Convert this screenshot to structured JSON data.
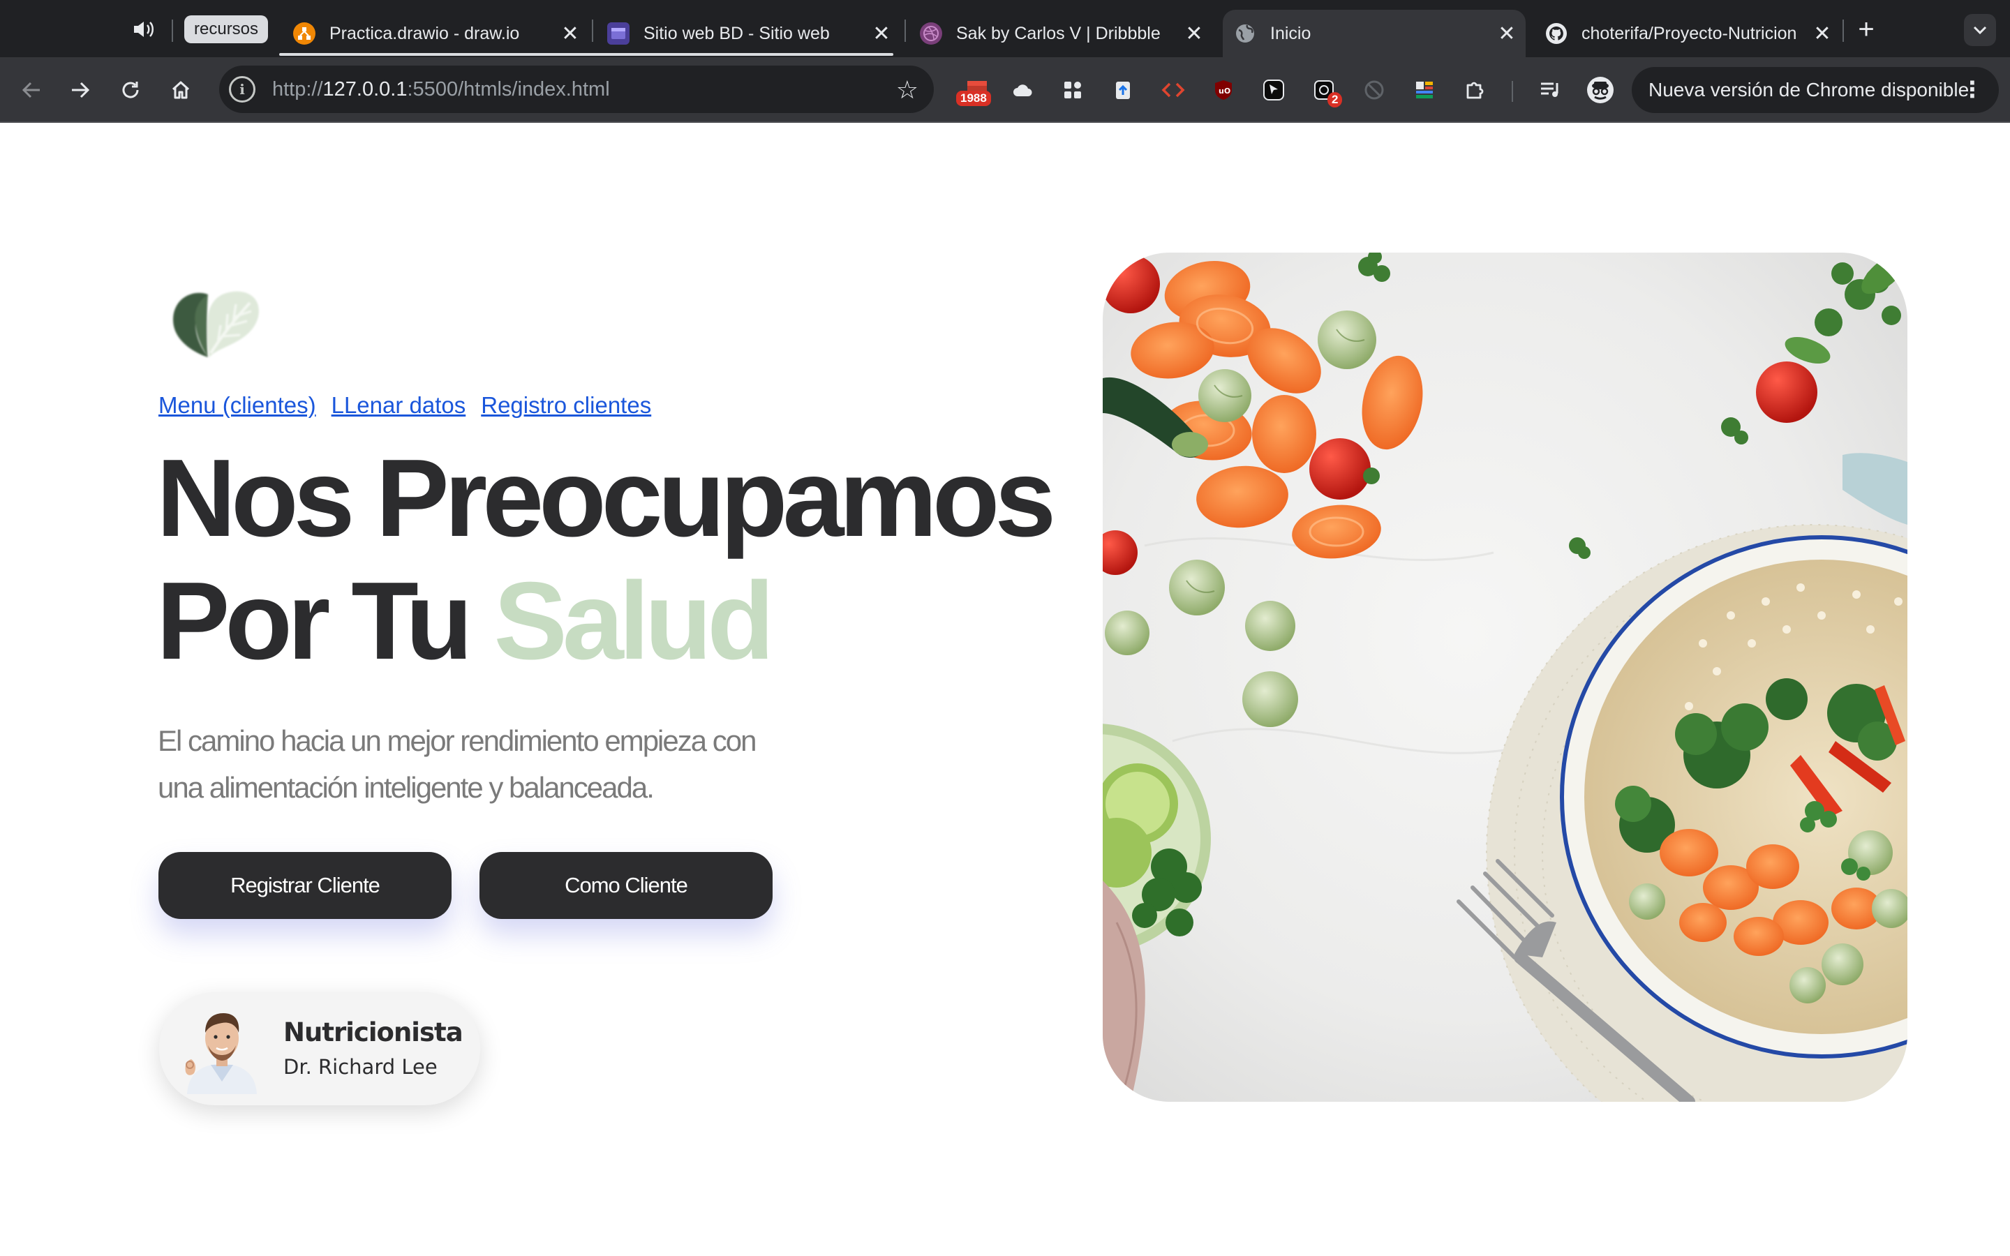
{
  "browser": {
    "tab_group_label": "recursos",
    "tabs": [
      {
        "title": "Practica.drawio - draw.io",
        "favicon": "drawio-icon",
        "active": false
      },
      {
        "title": "Sitio web BD - Sitio web",
        "favicon": "site-icon",
        "active": false
      },
      {
        "title": "Sak by Carlos V | Dribbble",
        "favicon": "dribbble-icon",
        "active": false
      },
      {
        "title": "Inicio",
        "favicon": "globe-icon",
        "active": true
      },
      {
        "title": "choterifa/Proyecto-Nutricion",
        "favicon": "github-icon",
        "active": false
      }
    ],
    "url_prefix": "http://",
    "url_host": "127.0.0.1",
    "url_path": ":5500/htmls/index.html",
    "extension_badges": {
      "calendar": "1988",
      "notifications": "2"
    },
    "update_button_label": "Nueva versión de Chrome disponible"
  },
  "page": {
    "nav_links": [
      "Menu (clientes)",
      "LLenar datos",
      "Registro clientes"
    ],
    "hero": {
      "title_line1": "Nos Preocupamos",
      "title_line2_prefix": "Por Tu",
      "title_accent": "Salud",
      "subtitle_line1": "El camino hacia un mejor rendimiento empieza con",
      "subtitle_line2": "una alimentación inteligente y balanceada."
    },
    "buttons": {
      "register": "Registrar Cliente",
      "as_client": "Como Cliente"
    },
    "nutritionist_card": {
      "title": "Nutricionista",
      "name": "Dr. Richard Lee"
    }
  },
  "colors": {
    "title_dark": "#2c2c2e",
    "accent_green": "#c7dcc2",
    "link_blue": "#1a56db",
    "button_dark": "#2c2c2e",
    "chrome_dark": "#202124",
    "chrome_toolbar": "#35363a"
  }
}
